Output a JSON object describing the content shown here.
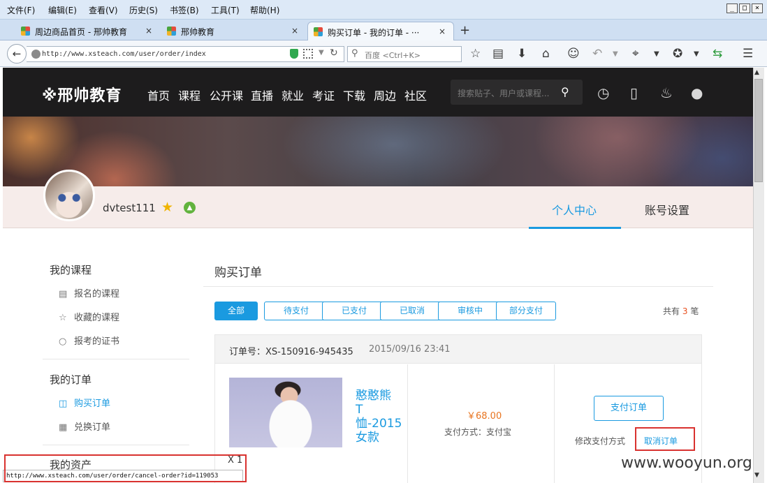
{
  "browser": {
    "menu": [
      "文件(F)",
      "编辑(E)",
      "查看(V)",
      "历史(S)",
      "书签(B)",
      "工具(T)",
      "帮助(H)"
    ],
    "window_controls": [
      "_",
      "□",
      "×"
    ],
    "tabs": [
      {
        "title": "周边商品首页 - 邢帅教育",
        "close": "×"
      },
      {
        "title": "邢帅教育",
        "close": "×"
      },
      {
        "title": "购买订单 - 我的订单 - ···",
        "close": "×"
      }
    ],
    "new_tab": "+",
    "url": "http://www.xsteach.com/user/order/index",
    "search_placeholder": "百度 <Ctrl+K>"
  },
  "site": {
    "logo": "※邢帅教育",
    "nav": [
      "首页",
      "课程",
      "公开课",
      "直播",
      "就业",
      "考证",
      "下载",
      "周边",
      "社区"
    ],
    "search_placeholder": "搜索贴子、用户或课程..."
  },
  "profile": {
    "username": "dvtest111",
    "tabs": [
      "个人中心",
      "账号设置"
    ]
  },
  "sidebar": {
    "sections": [
      {
        "title": "我的课程",
        "items": [
          "报名的课程",
          "收藏的课程",
          "报考的证书"
        ]
      },
      {
        "title": "我的订单",
        "items": [
          "购买订单",
          "兑换订单"
        ]
      },
      {
        "title": "我的资产",
        "items": []
      }
    ]
  },
  "main": {
    "title": "购买订单",
    "filters": [
      "全部",
      "待支付",
      "已支付",
      "已取消",
      "审核中",
      "部分支付"
    ],
    "total_prefix": "共有",
    "total_count": "3",
    "total_suffix": "笔"
  },
  "order": {
    "number": "订单号：XS-150916-945435",
    "time": "2015/09/16 23:41",
    "product_name": "憨憨熊T恤-2015女款",
    "price": "￥68.00",
    "pay_method": "支付方式：支付宝",
    "pay_button": "支付订单",
    "change_pay": "修改支付方式",
    "separator": "|",
    "cancel": "取消订单",
    "quantity": "X 1"
  },
  "status_bar": {
    "url": "http://www.xsteach.com/user/order/cancel-order?id=119053"
  },
  "watermark": "www.wooyun.org",
  "colors": {
    "accent": "#1a9ae0",
    "price": "#e8741f",
    "highlight": "#d9322f",
    "header_bg": "#1d1c1d"
  }
}
